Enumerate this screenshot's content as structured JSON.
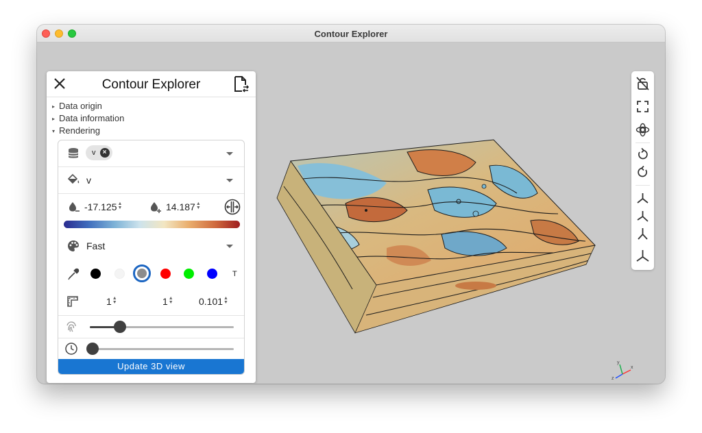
{
  "window": {
    "title": "Contour Explorer"
  },
  "panel": {
    "title": "Contour Explorer",
    "sections": [
      {
        "label": "Data origin",
        "expanded": false
      },
      {
        "label": "Data information",
        "expanded": false
      },
      {
        "label": "Rendering",
        "expanded": true
      }
    ],
    "rendering": {
      "array_chip": "v",
      "color_by": "v",
      "range_min": "-17.125",
      "range_max": "14.187",
      "colormap": [
        "#2a2b90",
        "#3f6dbd",
        "#7eb3d7",
        "#cde3ec",
        "#f2e6c2",
        "#eaae6d",
        "#cf6a3e",
        "#9e1d20"
      ],
      "preset": "Fast",
      "swatches": [
        {
          "color": "#000000",
          "selected": false
        },
        {
          "color": "#f4f4f4",
          "selected": false
        },
        {
          "color": "#8c8c8c",
          "selected": true
        },
        {
          "color": "#ff0000",
          "selected": false
        },
        {
          "color": "#00ee00",
          "selected": false
        },
        {
          "color": "#0000ff",
          "selected": false
        }
      ],
      "swatch_text_toggle": "T",
      "line_values": {
        "a": "1",
        "b": "1",
        "c": "0.101"
      },
      "resolution_slider": 0.21,
      "time_slider": 0.0,
      "update_button": "Update 3D view"
    }
  },
  "toolbar": {
    "icons": [
      "lock-off-icon",
      "fullscreen-icon",
      "rotate-interaction-icon",
      "rotate-left-icon",
      "rotate-right-icon",
      "view-x-icon",
      "view-y-icon",
      "view-z-icon",
      "view-iso-icon"
    ]
  },
  "scene": {
    "palette": {
      "ocean_low": "#7ab9d4",
      "ocean_high": "#d48a52",
      "land": "#e4c58e",
      "contour": "#1a1a1a"
    }
  }
}
